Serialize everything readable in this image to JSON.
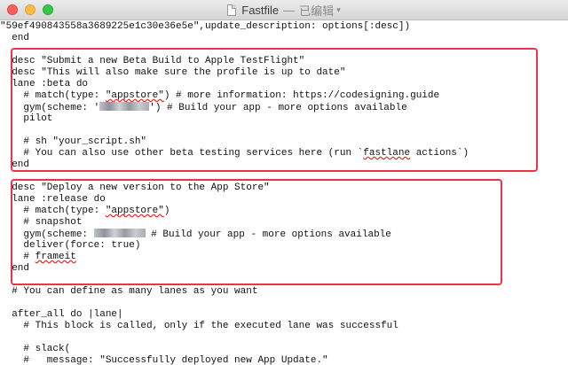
{
  "window": {
    "title": "Fastfile",
    "separator": "—",
    "status": "已编辑",
    "chevron": "▾"
  },
  "code": {
    "l1": "\"59ef490843558a3689225e1c30e36e5e\",update_description: options[:desc])",
    "l2": "  end",
    "l4": "  desc \"Submit a new Beta Build to Apple TestFlight\"",
    "l5": "  desc \"This will also make sure the profile is up to date\"",
    "l6": "  lane :beta do",
    "l7_a": "    # match(type: ",
    "l7_sq": "\"appstore\"",
    "l7_b": ") # more information: https://codesigning.guide",
    "l8_a": "    gym(scheme: '",
    "l8_b": "') # Build your app - more options available",
    "l9": "    pilot",
    "l11": "    # sh \"your_script.sh\"",
    "l12_a": "    # You can also use other beta testing services here (run `",
    "l12_sq": "fastlane",
    "l12_b": " actions`)",
    "l13": "  end",
    "l15": "  desc \"Deploy a new version to the App Store\"",
    "l16": "  lane :release do",
    "l17_a": "    # match(type: ",
    "l17_sq": "\"appstore\"",
    "l17_b": ")",
    "l18": "    # snapshot",
    "l19_a": "    gym(scheme: ",
    "l19_b": " # Build your app - more options available",
    "l20": "    deliver(force: true)",
    "l21_a": "    # ",
    "l21_sq": "frameit",
    "l22": "  end",
    "l24": "  # You can define as many lanes as you want",
    "l26": "  after_all do |lane|",
    "l27": "    # This block is called, only if the executed lane was successful",
    "l29": "    # slack(",
    "l30": "    #   message: \"Successfully deployed new App Update.\""
  },
  "colors": {
    "highlight_border": "#e9344a",
    "spellcheck": "#e0261b"
  }
}
